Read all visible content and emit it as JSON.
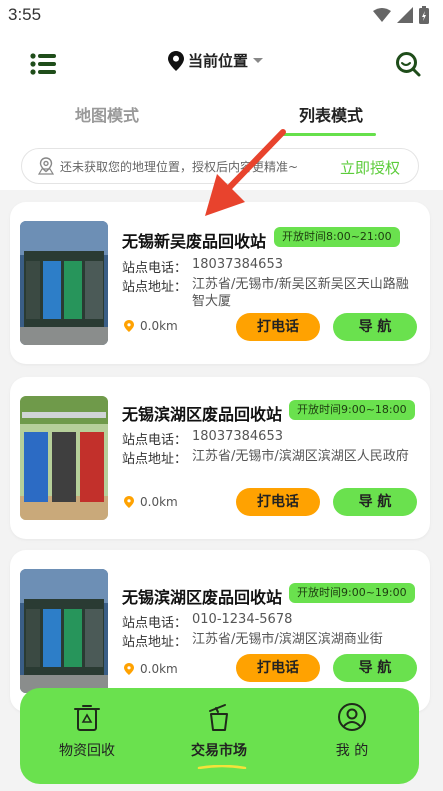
{
  "status_bar": {
    "time": "3:55"
  },
  "header": {
    "location_label": "当前位置",
    "tabs": [
      {
        "label": "地图模式",
        "active": false
      },
      {
        "label": "列表模式",
        "active": true
      }
    ],
    "notice_text": "还未获取您的地理位置，授权后内容更精准~",
    "notice_action": "立即授权"
  },
  "cards": [
    {
      "title": "无锡新吴废品回收站",
      "hours": "开放时间8:00~21:00",
      "phone_label": "站点电话：",
      "phone": "18037384653",
      "addr_label": "站点地址：",
      "addr": "江苏省/无锡市/新吴区新吴区天山路融智大厦",
      "distance": "0.0km",
      "call_label": "打电话",
      "nav_label": "导 航"
    },
    {
      "title": "无锡滨湖区废品回收站",
      "hours": "开放时间9:00~18:00",
      "phone_label": "站点电话：",
      "phone": "18037384653",
      "addr_label": "站点地址：",
      "addr": "江苏省/无锡市/滨湖区滨湖区人民政府",
      "distance": "0.0km",
      "call_label": "打电话",
      "nav_label": "导 航"
    },
    {
      "title": "无锡滨湖区废品回收站",
      "hours": "开放时间9:00~19:00",
      "phone_label": "站点电话：",
      "phone": "010-1234-5678",
      "addr_label": "站点地址：",
      "addr": "江苏省/无锡市/滨湖区滨湖商业街",
      "distance": "0.0km",
      "call_label": "打电话",
      "nav_label": "导 航"
    }
  ],
  "bottom_nav": [
    {
      "label": "物资回收",
      "icon": "recycle-bin-icon",
      "active": false
    },
    {
      "label": "交易市场",
      "icon": "trash-can-icon",
      "active": true
    },
    {
      "label": "我 的",
      "icon": "user-icon",
      "active": false
    }
  ],
  "colors": {
    "accent_green": "#6ae14e",
    "call_orange": "#ffa201",
    "link_green": "#5ccc3a",
    "annotation_red": "#e8432d"
  }
}
